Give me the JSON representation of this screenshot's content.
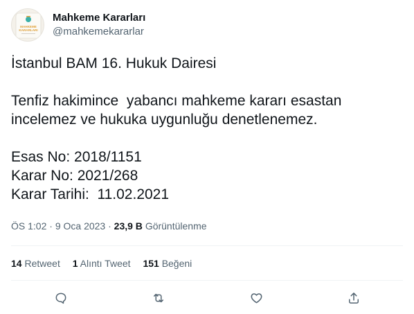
{
  "author": {
    "display_name": "Mahkeme Kararları",
    "handle": "@mahkemekararlar",
    "avatar_text_1": "MAHKEME",
    "avatar_text_2": "KARARLARI"
  },
  "tweet": {
    "lines": [
      "İstanbul BAM 16. Hukuk Dairesi",
      "",
      "Tenfiz hakimince  yabancı mahkeme kararı esastan",
      "incelemez ve hukuka uygunluğu denetlenemez.",
      "",
      "Esas No: 2018/1151",
      "Karar No: 2021/268",
      "Karar Tarihi:  11.02.2021"
    ]
  },
  "meta": {
    "time": "ÖS 1:02",
    "date": "9 Oca 2023",
    "views_count": "23,9 B",
    "views_label": "Görüntülenme"
  },
  "stats": {
    "retweets_count": "14",
    "retweets_label": "Retweet",
    "quotes_count": "1",
    "quotes_label": "Alıntı Tweet",
    "likes_count": "151",
    "likes_label": "Beğeni"
  },
  "icons": {
    "reply": "reply-icon",
    "retweet": "retweet-icon",
    "like": "heart-icon",
    "share": "share-icon"
  },
  "colors": {
    "text_primary": "#0f1419",
    "text_secondary": "#536471",
    "divider": "#eff3f4",
    "avatar_accent": "#e0a13a",
    "avatar_teal": "#3bb0a8"
  }
}
